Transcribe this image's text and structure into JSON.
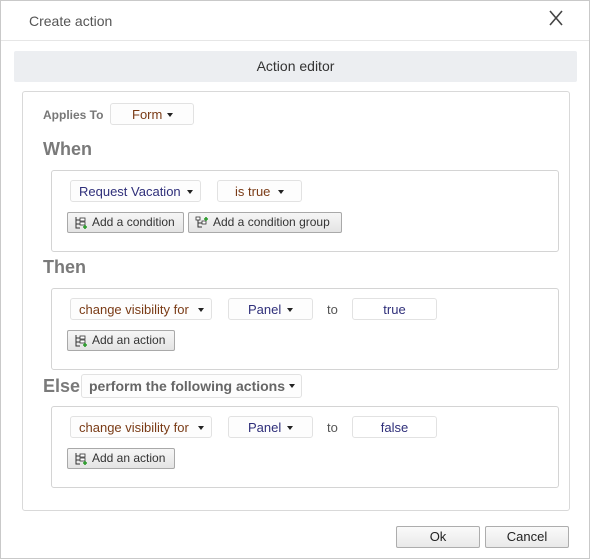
{
  "dialog": {
    "title": "Create action"
  },
  "editor": {
    "header": "Action editor",
    "applies_to": {
      "label": "Applies To",
      "value": "Form"
    },
    "when": {
      "heading": "When",
      "condition": {
        "field": "Request Vacation",
        "operator": "is true"
      },
      "add_condition": "Add a condition",
      "add_condition_group": "Add a condition group"
    },
    "then": {
      "heading": "Then",
      "action": {
        "verb": "change visibility for",
        "target": "Panel",
        "to": "to",
        "value": "true"
      },
      "add_action": "Add an action"
    },
    "else": {
      "heading": "Else",
      "mode": "perform the following actions",
      "action": {
        "verb": "change visibility for",
        "target": "Panel",
        "to": "to",
        "value": "false"
      },
      "add_action": "Add an action"
    }
  },
  "footer": {
    "ok": "Ok",
    "cancel": "Cancel"
  }
}
